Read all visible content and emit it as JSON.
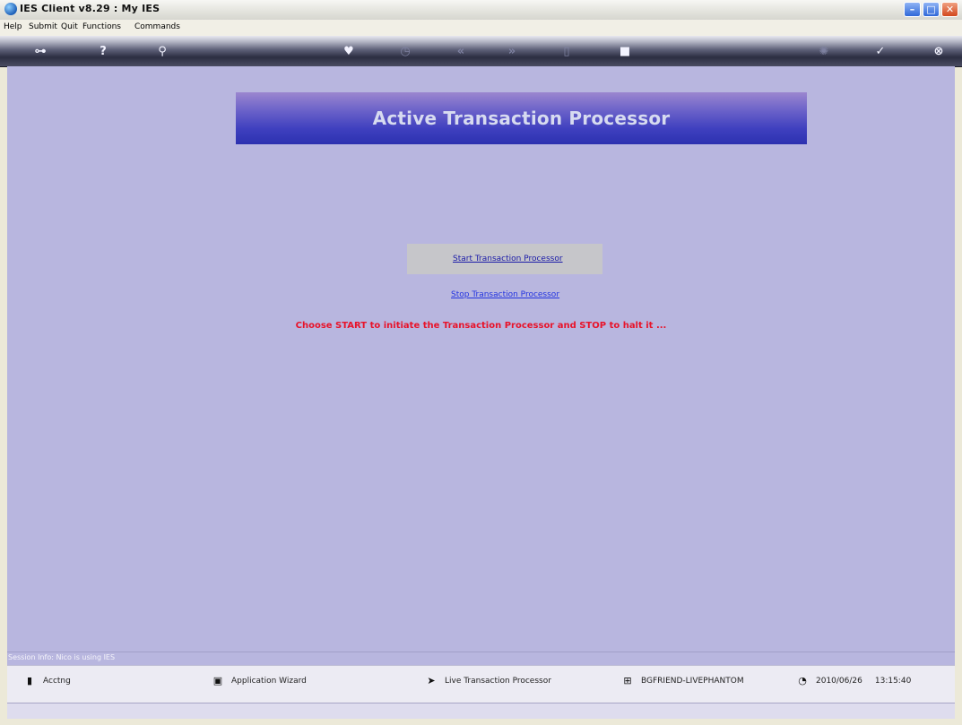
{
  "window": {
    "title": "IES Client v8.29 : My IES",
    "app_icon": "ies-globe-icon",
    "controls": {
      "minimize": "–",
      "maximize": "□",
      "close": "✕"
    }
  },
  "menu": {
    "items": [
      "Help",
      "Submit",
      "Quit",
      "Functions",
      "Commands"
    ]
  },
  "toolbar": {
    "icons": [
      {
        "name": "key-icon",
        "glyph": "⊶"
      },
      {
        "name": "help-icon",
        "glyph": "?"
      },
      {
        "name": "search-icon",
        "glyph": "⚲"
      },
      {
        "name": "heart-icon",
        "glyph": "♥"
      },
      {
        "name": "history-icon",
        "glyph": "◷"
      },
      {
        "name": "rewind-icon",
        "glyph": "«"
      },
      {
        "name": "forward-icon",
        "glyph": "»"
      },
      {
        "name": "calendar-icon",
        "glyph": "▯"
      },
      {
        "name": "stop-icon",
        "glyph": "■"
      },
      {
        "name": "settings-icon",
        "glyph": "✺"
      },
      {
        "name": "check-icon",
        "glyph": "✓"
      },
      {
        "name": "close-icon",
        "glyph": "⊗"
      }
    ]
  },
  "main": {
    "title": "Active Transaction Processor",
    "start_link": "Start Transaction Processor",
    "stop_link": "Stop Transaction Processor",
    "instruction": "Choose START to initiate the Transaction  Processor and STOP to halt it ..."
  },
  "session": {
    "text": "Session Info: Nico is using IES"
  },
  "status": {
    "acctng": "Acctng",
    "wizard": "Application Wizard",
    "processor": "Live Transaction Processor",
    "connection": "BGFRIEND-LIVEPHANTOM",
    "date": "2010/06/26",
    "time": "13:15:40"
  }
}
